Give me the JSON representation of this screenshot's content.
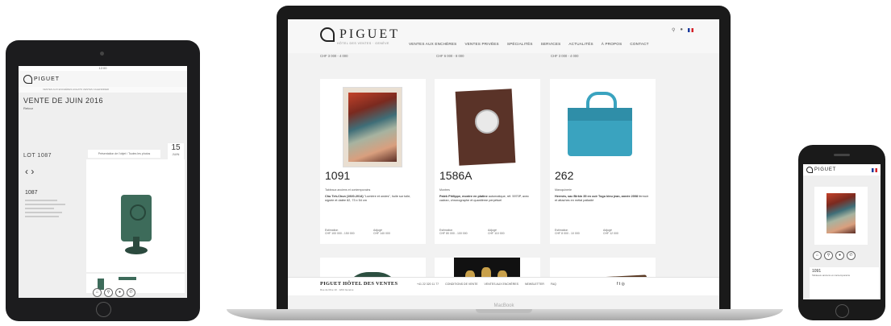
{
  "ipad": {
    "status": "12:00",
    "logo": "PIGUET",
    "nav": "VENTES AUX ENCHÈRES   ACHATS   VENTES   CALENDRIER",
    "title": "VENTE DE JUIN 2016",
    "subtitle": "Retour",
    "lot_label": "LOT 1087",
    "tab": "Présentation de l'objet / Toutes les photos",
    "date_day": "15",
    "date_month": "JUIN",
    "lot_number": "1087",
    "icons": [
      "auction-icon",
      "search-icon",
      "user-icon",
      "phone-icon"
    ]
  },
  "mac": {
    "label": "MacBook",
    "site": {
      "logo": "PIGUET",
      "tagline": "HÔTEL DES VENTES · GENÈVE",
      "nav": [
        "VENTES AUX ENCHÈRES",
        "VENTES PRIVÉES",
        "SPÉCIALITÉS",
        "SERVICES",
        "ACTUALITÉS",
        "À PROPOS",
        "CONTACT"
      ],
      "est_row": [
        "CHF 3 000 - 4 000",
        "CHF 6 000 - 8 000",
        "CHF 3 000 - 4 000"
      ]
    },
    "lots": [
      {
        "number": "1091",
        "category": "Tableaux anciens et contemporains",
        "title": "Chu Teh-Chun (1920-2014)",
        "desc": "\"Lumière et ondes\", huile sur toile, signée et datée 82, 73 x 54 cm",
        "est_label": "Estimation",
        "est": "CHF 100 000 - 150 000",
        "result_label": "Adjugé",
        "result": "CHF 140 000"
      },
      {
        "number": "1586A",
        "category": "Montres",
        "title": "Patek Philippe, montre en platine",
        "desc": "automatique, réf. 5970P, avec cadran, chronographe et quantième perpétuel",
        "est_label": "Estimation",
        "est": "CHF 80 000 - 100 000",
        "result_label": "Adjugé",
        "result": "CHF 110 000"
      },
      {
        "number": "262",
        "category": "Maroquinerie",
        "title": "Hermès, sac Birkin 35 en cuir Togo bleu jean, année 2008",
        "desc": "fermoir et attaches en métal palladié",
        "est_label": "Estimation",
        "est": "CHF 8 000 - 10 000",
        "result_label": "Adjugé",
        "result": "CHF 12 000"
      }
    ],
    "footer": {
      "brand": "PIGUET HÔTEL DES VENTES",
      "address": "Rue de Rive 10 · 1204 Genève",
      "links": [
        "+41 22 320 11 77",
        "CONDITIONS DE VENTE",
        "VENTES AUX ENCHÈRES",
        "NEWSLETTER",
        "FAQ"
      ],
      "social": "f  t  ◎"
    }
  },
  "iphone": {
    "logo": "PIGUET",
    "lot": "1091",
    "info": "Tableaux anciens et contemporains"
  }
}
